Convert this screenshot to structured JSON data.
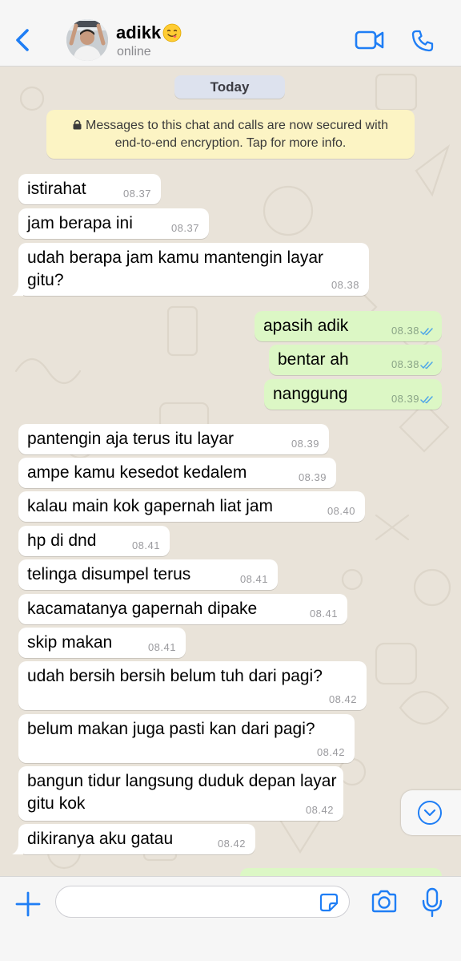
{
  "header": {
    "contact_name": "adikk",
    "status": "online"
  },
  "chat": {
    "date_label": "Today",
    "encryption_notice": "Messages to this chat and calls are now secured with end-to-end encryption. Tap for more info.",
    "messages": [
      {
        "direction": "in",
        "text": "istirahat",
        "time": "08.37"
      },
      {
        "direction": "in",
        "text": "jam berapa ini",
        "time": "08.37"
      },
      {
        "direction": "in",
        "text": "udah berapa jam kamu mantengin layar gitu?",
        "time": "08.38"
      },
      {
        "direction": "out",
        "text": "apasih adik",
        "time": "08.38",
        "read": true
      },
      {
        "direction": "out",
        "text": "bentar ah",
        "time": "08.38",
        "read": true
      },
      {
        "direction": "out",
        "text": "nanggung",
        "time": "08.39",
        "read": true
      },
      {
        "direction": "in",
        "text": "pantengin aja terus itu layar",
        "time": "08.39"
      },
      {
        "direction": "in",
        "text": "ampe kamu kesedot kedalem",
        "time": "08.39"
      },
      {
        "direction": "in",
        "text": "kalau main kok gapernah liat jam",
        "time": "08.40"
      },
      {
        "direction": "in",
        "text": "hp di dnd",
        "time": "08.41"
      },
      {
        "direction": "in",
        "text": "telinga disumpel terus",
        "time": "08.41"
      },
      {
        "direction": "in",
        "text": "kacamatanya gapernah dipake",
        "time": "08.41"
      },
      {
        "direction": "in",
        "text": "skip makan",
        "time": "08.41"
      },
      {
        "direction": "in",
        "text": "udah bersih bersih belum tuh dari pagi?",
        "time": "08.42"
      },
      {
        "direction": "in",
        "text": "belum makan juga pasti kan dari pagi?",
        "time": "08.42"
      },
      {
        "direction": "in",
        "text": "bangun tidur langsung duduk depan layar gitu kok",
        "time": "08.42"
      },
      {
        "direction": "in",
        "text": "dikiranya aku gatau",
        "time": "08.42"
      }
    ]
  },
  "input": {
    "value": "",
    "placeholder": ""
  },
  "colors": {
    "accent": "#1f7ef5",
    "incoming_bubble": "#ffffff",
    "outgoing_bubble": "#dcf7c5",
    "chat_background": "#e9e3d9",
    "read_ticks": "#4fa6e8",
    "date_pill": "#dde2ee",
    "encryption_notice": "#fcf4c4"
  },
  "icons": [
    "chevron-left-icon",
    "avatar",
    "smiling-face-emoji",
    "video-camera-icon",
    "phone-icon",
    "lock-icon",
    "double-check-icon",
    "chevron-down-icon",
    "plus-icon",
    "sticker-icon",
    "camera-icon",
    "microphone-icon"
  ]
}
